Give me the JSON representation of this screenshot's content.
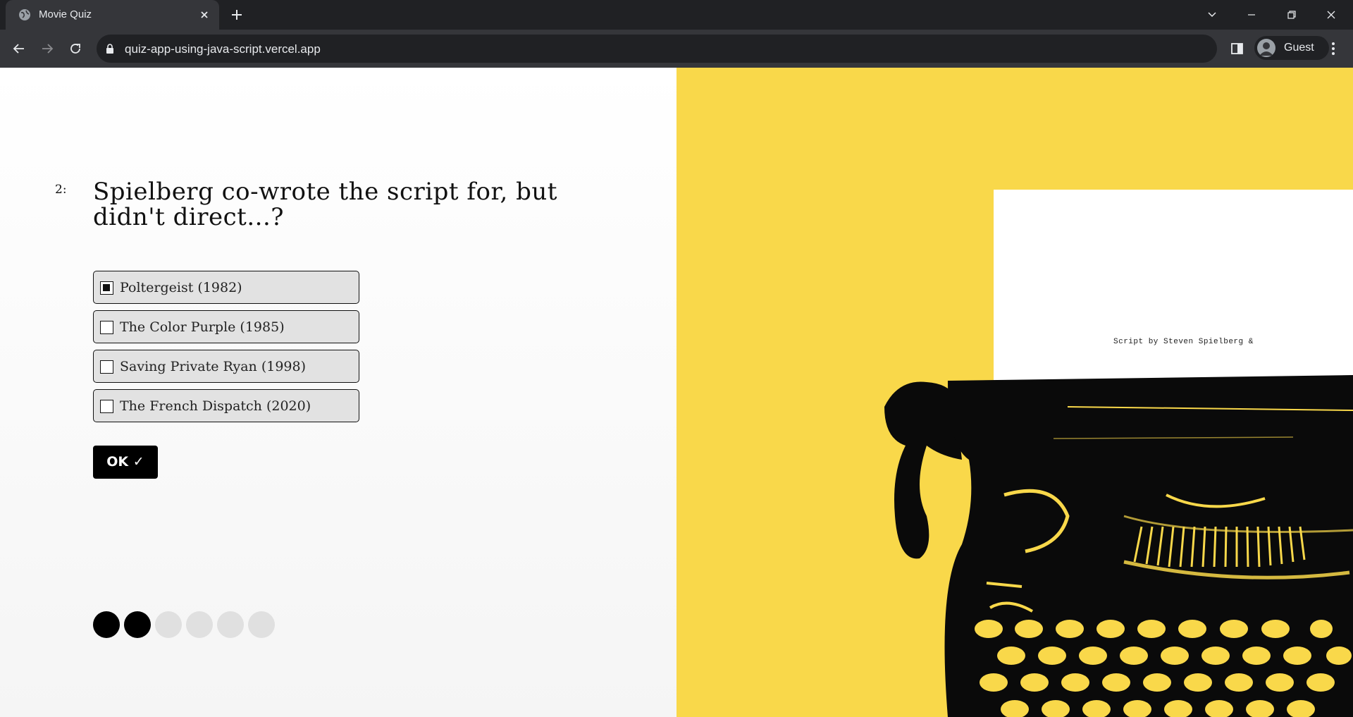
{
  "browser": {
    "tab_title": "Movie Quiz",
    "url": "quiz-app-using-java-script.vercel.app",
    "profile_label": "Guest"
  },
  "quiz": {
    "question_number": "2:",
    "question_text": "Spielberg co-wrote the script for, but didn't direct...?",
    "options": [
      {
        "label": "Poltergeist (1982)",
        "checked": true
      },
      {
        "label": "The Color Purple (1985)",
        "checked": false
      },
      {
        "label": "Saving Private Ryan (1998)",
        "checked": false
      },
      {
        "label": "The French Dispatch (2020)",
        "checked": false
      }
    ],
    "ok_label": "OK ✓",
    "progress": {
      "total": 6,
      "completed": 2
    }
  },
  "illustration": {
    "paper_text": "Script by Steven Spielberg &",
    "colors": {
      "background": "#f9d84a",
      "ink": "#000000",
      "paper": "#ffffff"
    }
  }
}
